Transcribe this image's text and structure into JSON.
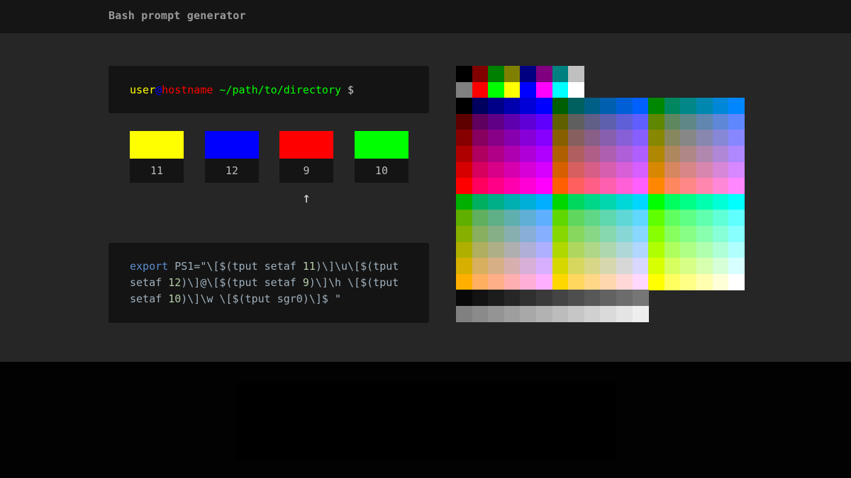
{
  "header": {
    "title": "Bash prompt generator"
  },
  "prompt_preview": {
    "segments": [
      {
        "text": "user",
        "color": "#ffff00"
      },
      {
        "text": "@",
        "color": "#0000ff"
      },
      {
        "text": "hostname",
        "color": "#ff0000"
      },
      {
        "text": " ~/path/to/directory",
        "color": "#00ff00"
      },
      {
        "text": " $",
        "color": "#cccccc"
      }
    ]
  },
  "swatches": [
    {
      "color": "#ffff00",
      "label": "11"
    },
    {
      "color": "#0000ff",
      "label": "12"
    },
    {
      "color": "#ff0000",
      "label": "9"
    },
    {
      "color": "#00ff00",
      "label": "10"
    }
  ],
  "selection_arrow": "↑",
  "code": {
    "lines": [
      "export PS1=\"\\[$(tput setaf 11)\\]\\u\\[$(tput",
      "setaf 12)\\]@\\[$(tput setaf 9)\\]\\h \\[$(tput",
      "setaf 10)\\]\\w \\[$(tput sgr0)\\]$ \""
    ],
    "colors": {
      "keyword": "#5b8fcf",
      "number": "#b5cea8",
      "text": "#a6b3bc"
    }
  },
  "palette": {
    "system_colors": [
      "#000000",
      "#800000",
      "#008000",
      "#808000",
      "#000080",
      "#800080",
      "#008080",
      "#c0c0c0",
      "#808080",
      "#ff0000",
      "#00ff00",
      "#ffff00",
      "#0000ff",
      "#ff00ff",
      "#00ffff",
      "#ffffff"
    ],
    "cube_levels": [
      0,
      95,
      135,
      175,
      215,
      255
    ],
    "grayscale_count": 24
  },
  "ad_placeholder": {}
}
